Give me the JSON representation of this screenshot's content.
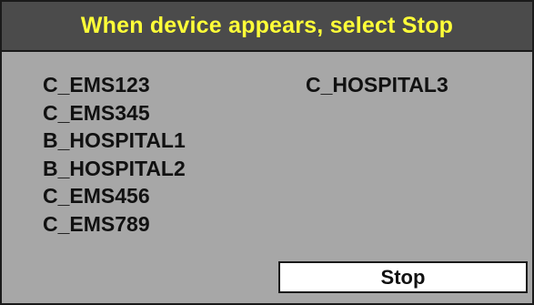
{
  "header": {
    "title": "When device appears, select Stop"
  },
  "devices": {
    "left": [
      "C_EMS123",
      "C_EMS345",
      "B_HOSPITAL1",
      "B_HOSPITAL2",
      "C_EMS456",
      "C_EMS789"
    ],
    "right": [
      "C_HOSPITAL3"
    ]
  },
  "controls": {
    "stop_label": "Stop"
  },
  "colors": {
    "background": "#a7a7a7",
    "header_background": "#4b4b4b",
    "header_text": "#ffff38",
    "button_background": "#ffffff",
    "border": "#1a1a1a"
  }
}
